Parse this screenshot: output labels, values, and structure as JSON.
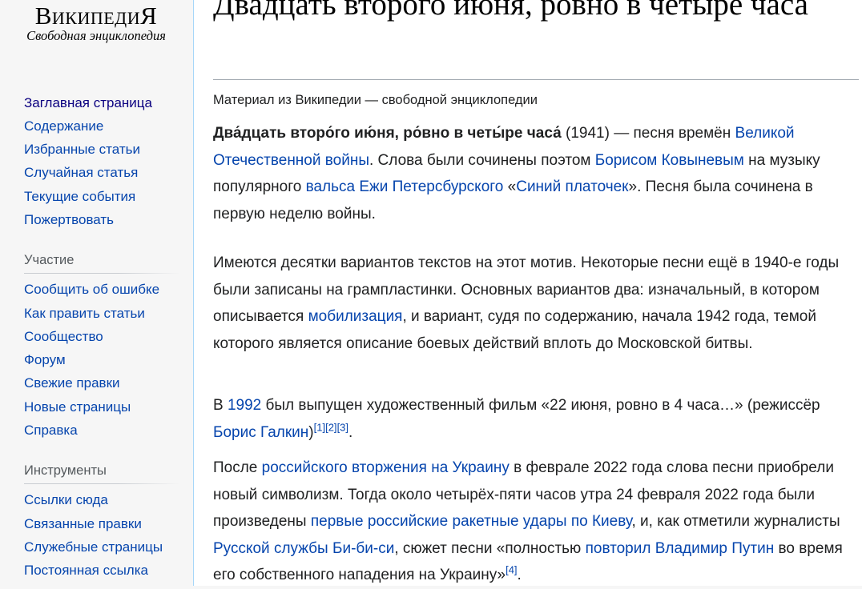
{
  "logo": {
    "title": "ВикипедиЯ",
    "subtitle": "Свободная энциклопедия"
  },
  "navigation": {
    "main_page": "Заглавная страница",
    "contents": "Содержание",
    "featured": "Избранные статьи",
    "random": "Случайная статья",
    "current_events": "Текущие события",
    "donate": "Пожертвовать"
  },
  "participation": {
    "heading": "Участие",
    "report_error": "Сообщить об ошибке",
    "how_to_edit": "Как править статьи",
    "community": "Сообщество",
    "forum": "Форум",
    "recent_changes": "Свежие правки",
    "new_pages": "Новые страницы",
    "help": "Справка"
  },
  "tools": {
    "heading": "Инструменты",
    "what_links_here": "Ссылки сюда",
    "related_changes": "Связанные правки",
    "special_pages": "Служебные страницы",
    "permanent_link": "Постоянная ссылка"
  },
  "article": {
    "title": "Двадцать второго июня, ровно в четыре часа",
    "site_sub": "Материал из Википедии — свободной энциклопедии",
    "p1": {
      "bold": "Два́дцать второ́го ию́ня, ро́вно в четы́ре часа́",
      "t1": " (1941) — песня времён ",
      "link_war": "Великой Отечественной войны",
      "t2": ". Слова были сочинены поэтом ",
      "link_poet": "Борисом Ковыневым",
      "t3": " на музыку популярного ",
      "link_waltz": "вальса Ежи Петерсбурского",
      "t4": " «",
      "link_song": "Синий платочек",
      "t5": "». Песня была сочинена в первую неделю войны."
    },
    "p2": {
      "t1": "Имеются десятки вариантов текстов на этот мотив. Некоторые песни ещё в 1940-е годы были записаны на грампластинки. Основных вариантов два: изначальный, в котором описывается ",
      "link_mobilization": "мобилизация",
      "t2": ", и вариант, судя по содержанию, начала 1942 года, темой которого является описание боевых действий вплоть до Московской битвы."
    },
    "p3": {
      "t1": "В ",
      "link_year": "1992",
      "t2": " был выпущен художественный фильм «22 июня, ровно в 4 часа…» (режиссёр ",
      "link_director": "Борис Галкин",
      "t3": ")",
      "ref1": "[1]",
      "ref2": "[2]",
      "ref3": "[3]",
      "t4": "."
    },
    "p4": {
      "t1": "После ",
      "link_invasion": "российского вторжения на Украину",
      "t2": " в феврале 2022 года слова песни приобрели новый символизм. Тогда около четырёх-пяти часов утра 24 февраля 2022 года были произведены ",
      "link_strikes": "первые российские ракетные удары по Киеву",
      "t3": ", и, как отметили журналисты ",
      "link_bbc": "Русской службы Би-би-си",
      "t4": ", сюжет песни «полностью ",
      "link_putin": "повторил Владимир Путин",
      "t5": " во время его собственного нападения на Украину»",
      "ref4": "[4]",
      "t6": "."
    }
  }
}
